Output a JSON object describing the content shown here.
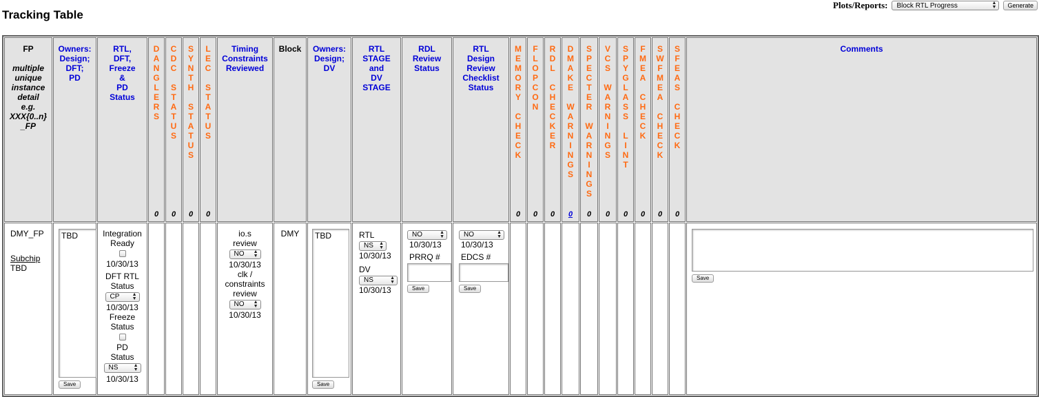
{
  "page": {
    "title": "Tracking Table"
  },
  "reports": {
    "label": "Plots/Reports:",
    "selected": "Block RTL Progress",
    "generate_label": "Generate"
  },
  "headers": {
    "fp": {
      "title": "FP",
      "subtitle": [
        "multiple",
        "unique",
        "instance",
        "detail",
        "e.g.",
        "XXX{0..n}",
        "_FP"
      ]
    },
    "owners_pd": [
      "Owners:",
      "Design;",
      "DFT;",
      "PD"
    ],
    "rtl_status": [
      "RTL,",
      "DFT,",
      "Freeze",
      "&",
      "PD",
      "Status"
    ],
    "danglers": {
      "letters": [
        "D",
        "A",
        "N",
        "G",
        "L",
        "E",
        "R",
        "S"
      ],
      "count": "0"
    },
    "cdc": {
      "letters": [
        "C",
        "D",
        "C",
        "",
        "S",
        "T",
        "A",
        "T",
        "U",
        "S"
      ],
      "count": "0"
    },
    "synth": {
      "letters": [
        "S",
        "Y",
        "N",
        "T",
        "H",
        "",
        "S",
        "T",
        "A",
        "T",
        "U",
        "S"
      ],
      "count": "0"
    },
    "lec": {
      "letters": [
        "L",
        "E",
        "C",
        "",
        "S",
        "T",
        "A",
        "T",
        "U",
        "S"
      ],
      "count": "0"
    },
    "timing": [
      "Timing",
      "Constraints",
      "Reviewed"
    ],
    "block": "Block",
    "owners_dv": [
      "Owners:",
      "Design;",
      "DV"
    ],
    "rtl_stage": [
      "RTL",
      "STAGE",
      "and",
      "DV",
      "STAGE"
    ],
    "rdl": [
      "RDL",
      "Review",
      "Status"
    ],
    "rtl_design": [
      "RTL",
      "Design",
      "Review",
      "Checklist",
      "Status"
    ],
    "memory": {
      "letters": [
        "M",
        "E",
        "M",
        "O",
        "R",
        "Y",
        "",
        "C",
        "H",
        "E",
        "C",
        "K"
      ],
      "count": "0"
    },
    "flopcon": {
      "letters": [
        "F",
        "L",
        "O",
        "P",
        "C",
        "O",
        "N"
      ],
      "count": "0"
    },
    "rdl_checker": {
      "letters": [
        "R",
        "D",
        "L",
        "",
        "C",
        "H",
        "E",
        "C",
        "K",
        "E",
        "R"
      ],
      "count": "0"
    },
    "dmake": {
      "letters": [
        "D",
        "M",
        "A",
        "K",
        "E",
        "",
        "W",
        "A",
        "R",
        "N",
        "I",
        "N",
        "G",
        "S"
      ],
      "count": "0"
    },
    "specter": {
      "letters": [
        "S",
        "P",
        "E",
        "C",
        "T",
        "E",
        "R",
        "",
        "W",
        "A",
        "R",
        "N",
        "I",
        "N",
        "G",
        "S"
      ],
      "count": "0"
    },
    "vcs": {
      "letters": [
        "V",
        "C",
        "S",
        "",
        "W",
        "A",
        "R",
        "N",
        "I",
        "N",
        "G",
        "S"
      ],
      "count": "0"
    },
    "spyglass": {
      "letters": [
        "S",
        "P",
        "Y",
        "G",
        "L",
        "A",
        "S",
        "S",
        "",
        "L",
        "I",
        "N",
        "T"
      ],
      "count": "0"
    },
    "fmea": {
      "letters": [
        "F",
        "M",
        "E",
        "A",
        "",
        "C",
        "H",
        "E",
        "C",
        "K"
      ],
      "count": "0"
    },
    "swfmea": {
      "letters": [
        "S",
        "W",
        "F",
        "M",
        "E",
        "A",
        "",
        "C",
        "H",
        "E",
        "C",
        "K"
      ],
      "count": "0"
    },
    "sfeas": {
      "letters": [
        "S",
        "F",
        "E",
        "A",
        "S",
        "",
        "C",
        "H",
        "E",
        "C",
        "K"
      ],
      "count": "0"
    },
    "comments": "Comments"
  },
  "row": {
    "fp": "DMY_FP",
    "subchip_link": "Subchip",
    "subchip_value": "TBD",
    "owners_pd_text": "TBD",
    "save_label": "Save",
    "integration_label": "Integration Ready",
    "integration_date": "10/30/13",
    "dft_label": "DFT RTL Status",
    "dft_value": "CP",
    "dft_date": "10/30/13",
    "freeze_label": "Freeze Status",
    "pd_label": "PD Status",
    "pd_value": "NS",
    "pd_date": "10/30/13",
    "ios_label": "io.s review",
    "ios_value": "NO",
    "ios_date": "10/30/13",
    "clk_label": "clk / constraints review",
    "clk_value": "NO",
    "clk_date": "10/30/13",
    "block": "DMY",
    "owners_dv_text": "TBD",
    "rtl_label": "RTL",
    "rtl_value": "NS",
    "rtl_date": "10/30/13",
    "dv_label": "DV",
    "dv_value": "NS",
    "dv_date": "10/30/13",
    "rdl_value": "NO",
    "rdl_date": "10/30/13",
    "prrq_label": "PRRQ #",
    "rtld_value": "NO",
    "rtld_date": "10/30/13",
    "edcs_label": "EDCS #"
  }
}
